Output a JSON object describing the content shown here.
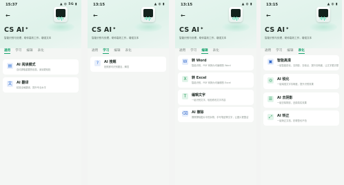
{
  "app": {
    "title": "CS AI",
    "subtitle": "智能识别与处理，助你高效工作，增强文本"
  },
  "icons": {
    "back": "arrow-left-icon",
    "title_badge": "sparkle-icon"
  },
  "colors": {
    "accent": "#17a36e"
  },
  "screens": [
    {
      "time": "15:37",
      "status": "▲ ◍ 5G ▮",
      "tabs": [
        "通用",
        "学习",
        "编辑",
        "表化"
      ],
      "active_tab": 0,
      "cards": [
        {
          "icon": "reading-mode-icon",
          "title": "AI 阅读模式",
          "desc": "自动提取重要的信息，阅读更轻松"
        },
        {
          "icon": "translate-icon",
          "title": "AI 翻译",
          "desc": "精准全局翻译，提升专业水平"
        }
      ]
    },
    {
      "time": "13:15",
      "status": "▲ ◍ ▮",
      "tabs": [
        "通用",
        "学习",
        "编辑",
        "表化"
      ],
      "active_tab": 1,
      "cards": [
        {
          "icon": "search-question-icon",
          "title": "AI 搜题",
          "desc": "拍照即可识别题目，解答"
        }
      ]
    },
    {
      "time": "13:15",
      "status": "▲ ◍ ▮",
      "tabs": [
        "通用",
        "学习",
        "编辑",
        "表化"
      ],
      "active_tab": 2,
      "cards": [
        {
          "icon": "word-icon",
          "title": "转 Word",
          "desc": "智能识别，PDF 转换为可编辑的 Word"
        },
        {
          "icon": "excel-icon",
          "title": "转 Excel",
          "desc": "智能识别，PDF 转换为可编辑的 Excel"
        },
        {
          "icon": "edit-text-icon",
          "title": "编辑文字",
          "desc": "一键识别文字，轻松修改文字内容"
        },
        {
          "icon": "erase-icon",
          "title": "AI 擦除",
          "desc": "擦擦擦除图片中的杂物，手写笔迹等文字，让图片更整洁"
        }
      ]
    },
    {
      "time": "13:15",
      "status": "▲ ◍ ▮",
      "tabs": [
        "通用",
        "学习",
        "编辑",
        "表化"
      ],
      "active_tab": 3,
      "cards": [
        {
          "icon": "enhance-icon",
          "title": "智能高清",
          "desc": "一键智能锐化，去阴影、去噪点、提升清晰度，让文字更清楚"
        },
        {
          "icon": "sharpen-icon",
          "title": "AI 锐化",
          "desc": "一键增强文字清晰度，提升识别效果"
        },
        {
          "icon": "remove-shadow-icon",
          "title": "AI 去阴影",
          "desc": "一键去除阴影，还原真实效果"
        },
        {
          "icon": "perspective-icon",
          "title": "AI 矫正",
          "desc": "一键矫正文档，拍得歪也不怕"
        }
      ]
    }
  ]
}
